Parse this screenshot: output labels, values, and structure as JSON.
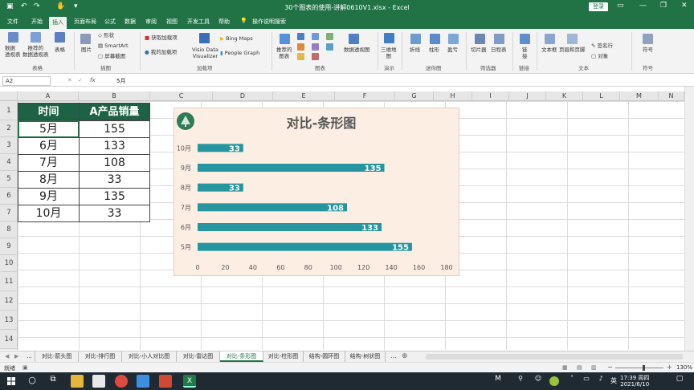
{
  "window": {
    "title": "30个图表的使用-讲解0610V1.xlsx - Excel",
    "login_label": "登录"
  },
  "menu": [
    "文件",
    "开始",
    "插入",
    "页面布局",
    "公式",
    "数据",
    "审阅",
    "视图",
    "开发工具",
    "帮助"
  ],
  "menu_search": "操作说明搜索",
  "ribbon": {
    "pivot": "数据\n透视表",
    "rec_pivot": "推荐的\n数据透视表",
    "table": "表格",
    "picture": "图片",
    "shapes": "形状",
    "smartart": "SmartArt",
    "screenshot": "屏幕截图",
    "get_addins": "获取加载项",
    "my_addins": "我的加载项",
    "visio": "Visio Data\nVisualizer",
    "bing_maps": "Bing Maps",
    "people_graph": "People Graph",
    "rec_charts": "推荐的\n图表",
    "pivot_chart": "数据透视图",
    "map3d": "三维地\n图",
    "line": "折线",
    "column": "柱形",
    "winloss": "盈亏",
    "slicer": "切片器",
    "timeline": "日程表",
    "link": "链\n接",
    "textbox": "文本框",
    "header_footer": "页眉和页脚",
    "signature": "签名行",
    "object": "对象",
    "symbol": "符号",
    "groups": {
      "tables": "表格",
      "illustrations": "插图",
      "addins": "加载项",
      "charts": "图表",
      "tours": "演示",
      "sparklines": "迷你图",
      "filters": "筛选器",
      "links": "链接",
      "text": "文本",
      "symbols": "符号"
    }
  },
  "formula": {
    "namebox": "A2",
    "fx": "fx",
    "value": "5月"
  },
  "columns": [
    "A",
    "B",
    "C",
    "D",
    "E",
    "F",
    "G",
    "H",
    "I",
    "J",
    "K",
    "L",
    "M",
    "N"
  ],
  "rows": [
    "1",
    "2",
    "3",
    "4",
    "5",
    "6",
    "7",
    "8",
    "9",
    "10",
    "11",
    "12",
    "13",
    "14"
  ],
  "table": {
    "headers": [
      "时间",
      "A产品销量"
    ],
    "rows": [
      [
        "5月",
        "155"
      ],
      [
        "6月",
        "133"
      ],
      [
        "7月",
        "108"
      ],
      [
        "8月",
        "33"
      ],
      [
        "9月",
        "135"
      ],
      [
        "10月",
        "33"
      ]
    ]
  },
  "chart_data": {
    "type": "bar",
    "title": "对比-条形图",
    "categories": [
      "5月",
      "6月",
      "7月",
      "8月",
      "9月",
      "10月"
    ],
    "values": [
      155,
      133,
      108,
      33,
      135,
      33
    ],
    "xlim": [
      0,
      180
    ],
    "xticks": [
      0,
      20,
      40,
      60,
      80,
      100,
      120,
      140,
      160,
      180
    ],
    "bar_color": "#2596a0",
    "background": "#fdeee4",
    "grid": false,
    "orientation": "horizontal"
  },
  "sheets": [
    "...",
    "对比-箭头图",
    "对比-排行图",
    "对比-小人对比图",
    "对比-雷达图",
    "对比-条形图",
    "对比-柱形图",
    "结构-圆环图",
    "结构-树状图"
  ],
  "status": {
    "ready": "就绪",
    "zoom": "130%"
  },
  "clock": {
    "time": "17:39 周四",
    "date": "2021/6/10"
  },
  "tray_lang": "英"
}
